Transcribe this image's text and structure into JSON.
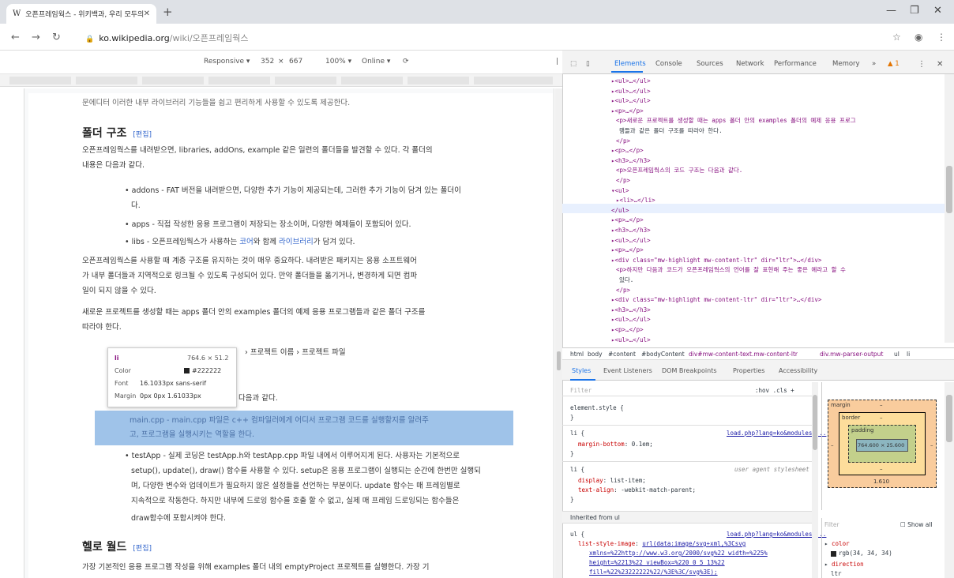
{
  "browser": {
    "tab_title": "오픈프레임웍스 - 위키백과, 우리 모두의 백과사전",
    "tab_favicon": "W",
    "url_host": "ko.wikipedia.org",
    "url_path": "/wiki/오픈프레임웍스"
  },
  "device_toolbar": {
    "mode": "Responsive ▾",
    "width": "352",
    "times": "×",
    "height": "667",
    "zoom": "100% ▾",
    "network": "Online ▾"
  },
  "article": {
    "intro_line": "문에디터 이러한 내부 라이브러리 기능들을 쉽고 편리하게 사용할 수 있도록 제공한다.",
    "section1_title": "폴더 구조",
    "edit_label": "[편집]",
    "p1_l1": "오픈프레임웍스를 내려받으면, libraries, addOns, example 같은 일련의 폴더들을 발견할 수 있다. 각 폴더의",
    "p1_l2": "내용은 다음과 같다.",
    "b1_l1": "• addons - FAT 버전을 내려받으면, 다양한 추가 기능이 제공되는데, 그러한 추가 기능이 담겨 있는 폴더이",
    "b1_l2": "다.",
    "b2": "• apps - 직접 작성한 응용 프로그램이 저장되는 장소이며, 다양한 예제들이 포함되어 있다.",
    "b3_pre": "• libs - 오픈프레임웍스가 사용하는 ",
    "b3_link1": "코어",
    "b3_mid": "와 함께 ",
    "b3_link2": "라이브러리",
    "b3_post": "가 담겨 있다.",
    "p2_l1": "오픈프레임웍스를 사용할 때 계층 구조를 유지하는 것이 매우 중요하다. 내려받은 패키지는 응용 소프트웨어",
    "p2_l2": "가 내부 폴더들과 지역적으로 링크될 수 있도록 구성되어 있다. 만약 폴더들을 옮기거나, 변경하게 되면 컴파",
    "p2_l3": "일이 되지 않을 수 있다.",
    "p3_l1": "새로운 프로젝트를 생성할 때는 apps 폴더 안의 examples 폴더의 예제 응용 프로그램들과 같은 폴더 구조를",
    "p3_l2": "따라야 한다.",
    "path_line": "› 프로젝트 이름 › 프로젝트 파일",
    "p4_tail": "다음과 같다.",
    "hl_l1": "main.cpp - main.cpp 파일은 c++ 컴파일러에게 어디서 프로그램 코드를 실행할지를 알려주",
    "hl_l2": "고, 프로그램을 실행시키는 역할을 한다.",
    "b5_l1": "• testApp - 실제 코딩은 testApp.h와 testApp.cpp 파일 내에서 이루어지게 된다. 사용자는 기본적으로",
    "b5_l2": "setup(), update(), draw() 함수를 사용할 수 있다. setup은 응용 프로그램이 실행되는 순간에 한번만 실행되",
    "b5_l3": "며, 다양한 변수와 업데이트가 필요하지 않은 설정들을 선언하는 부분이다. update 함수는 매 프레임별로",
    "b5_l4": "지속적으로 작동한다. 하지만 내부에 드로잉 함수를 호출 할 수 없고, 실제 매 프레임 드로잉되는 함수들은",
    "b5_l5": "draw함수에 포함시켜야 한다.",
    "section2_title": "헬로 월드",
    "p6": "가장 기본적인 응용 프로그램 작성을 위해 examples 폴더 내의 emptyProject 프로젝트를 실행한다. 가장 기"
  },
  "tooltip": {
    "tag": "li",
    "size": "764.6 × 51.2",
    "color_label": "Color",
    "color_value": "#222222",
    "font_label": "Font",
    "font_value": "16.1033px sans-serif",
    "margin_label": "Margin",
    "margin_value": "0px 0px 1.61033px"
  },
  "devtools": {
    "tabs": [
      "Elements",
      "Console",
      "Sources",
      "Network",
      "Performance",
      "Memory",
      "»"
    ],
    "warn_count": "▲ 1",
    "elements": [
      "▸<ul>…</ul>",
      "▸<ul>…</ul>",
      "▸<ul>…</ul>",
      "▸<p>…</p>",
      "<p>새로운 프로젝트를 생성할 때는 apps 폴더 안의 examples 폴더의 예제 응용 프로그",
      "램들과 같은 폴더 구조를 따라야 한다.",
      "</p>",
      "▸<p>…</p>",
      "▸<h3>…</h3>",
      "<p>오픈프레임웍스의 코드 구조는 다음과 같다.",
      "</p>",
      "▾<ul>",
      "▸<li>…</li>",
      "</ul>",
      "▸<p>…</p>",
      "▸<h3>…</h3>",
      "▸<ul>…</ul>",
      "▸<p>…</p>",
      "▸<div class=\"mw-highlight mw-content-ltr\" dir=\"ltr\">…</div>",
      "<p>하지만 다음과 코드가 오픈프레임웍스의 언어를 잘 표현해 주는 좋은 예라고 할 수",
      "있다.",
      "</p>",
      "▸<div class=\"mw-highlight mw-content-ltr\" dir=\"ltr\">…</div>",
      "▸<h3>…</h3>",
      "▸<ul>…</ul>",
      "▸<p>…</p>",
      "▸<ul>…</ul>"
    ],
    "breadcrumbs": [
      "html",
      "body",
      "#content",
      "#bodyContent",
      "div#mw-content-text.mw-content-ltr",
      "div.mw-parser-output",
      "ul",
      "li"
    ],
    "style_tabs": [
      "Styles",
      "Event Listeners",
      "DOM Breakpoints",
      "Properties",
      "Accessibility"
    ],
    "filter_placeholder": "Filter",
    "hov_cls": ":hov .cls +",
    "styles": {
      "element_style": "element.style {",
      "close": "}",
      "r1_sel": "li {",
      "r1_src": "load.php?lang=ko&modules=...",
      "r1_prop": "margin-bottom",
      "r1_val": "0.1em;",
      "r2_sel": "li {",
      "r2_src": "user agent stylesheet",
      "r2_p1": "display",
      "r2_v1": "list-item;",
      "r2_p2": "text-align",
      "r2_v2": "-webkit-match-parent;",
      "inherited": "Inherited from ul",
      "r3_sel": "ul {",
      "r3_src": "load.php?lang=ko&modules=...",
      "r3_prop": "list-style-image",
      "r3_l1": "url(data:image/svg+xml,%3Csvg",
      "r3_l2": "xmlns=%22http://www.w3.org/2000/svg%22 width=%225%",
      "r3_l3": "height=%2213%22 viewBox=%220 0 5 13%22",
      "r3_l4": "fill=%22%23222222%22/%3E%3C/svg%3E);"
    },
    "box_model": {
      "margin_label": "margin",
      "border_label": "border",
      "padding_label": "padding",
      "content": "764.600 × 25.600",
      "dash": "–",
      "bottom_margin": "1.610"
    },
    "computed": {
      "filter": "Filter",
      "show_all": "Show all",
      "p1": "color",
      "v1": "rgb(34, 34, 34)",
      "p2": "direction",
      "v2": "ltr"
    }
  },
  "colors": {
    "accent": "#1a73e8",
    "highlight": "#9fc3e9",
    "link": "#3366cc"
  }
}
